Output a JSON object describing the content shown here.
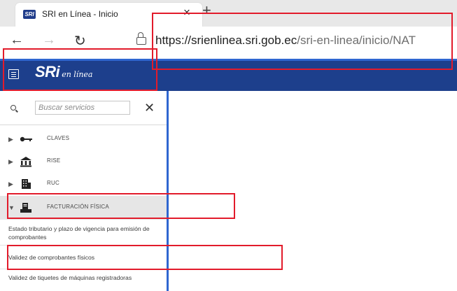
{
  "browser": {
    "tab_title": "SRI en Línea - Inicio",
    "favicon_text": "SRI",
    "close_glyph": "×",
    "newtab_glyph": "+",
    "back_glyph": "←",
    "forward_glyph": "→",
    "reload_glyph": "↻",
    "url_domain": "https://srienlinea.sri.gob.ec",
    "url_path": "/sri-en-linea/inicio/NAT"
  },
  "header": {
    "logo_main": "SRi",
    "logo_sub": "en línea"
  },
  "search": {
    "placeholder": "Buscar servicios",
    "clear_glyph": "✕"
  },
  "menu": {
    "items": [
      {
        "label": "CLAVES",
        "icon": "key-icon"
      },
      {
        "label": "RISE",
        "icon": "building-icon"
      },
      {
        "label": "RUC",
        "icon": "office-icon"
      },
      {
        "label": "FACTURACIÓN FÍSICA",
        "icon": "invoice-icon",
        "expanded": true
      }
    ],
    "subitems": [
      "Estado tributario y plazo de vigencia para emisión de comprobantes",
      "Validez de comprobantes físicos",
      "Validez de tiquetes de máquinas registradoras"
    ]
  },
  "colors": {
    "header_blue": "#1d3f8c",
    "accent_blue": "#2f66d0",
    "highlight_red": "#e21b2b"
  }
}
